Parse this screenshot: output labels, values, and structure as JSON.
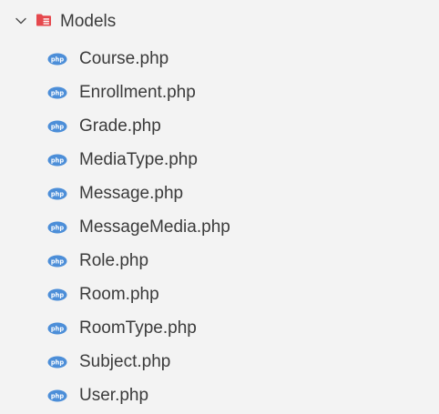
{
  "folder": {
    "name": "Models",
    "expanded": true,
    "icon": "folder-open-icon",
    "chevron_icon": "chevron-down-icon",
    "icon_color": "#e5484d"
  },
  "files": [
    {
      "name": "Course.php",
      "icon": "php-icon"
    },
    {
      "name": "Enrollment.php",
      "icon": "php-icon"
    },
    {
      "name": "Grade.php",
      "icon": "php-icon"
    },
    {
      "name": "MediaType.php",
      "icon": "php-icon"
    },
    {
      "name": "Message.php",
      "icon": "php-icon"
    },
    {
      "name": "MessageMedia.php",
      "icon": "php-icon"
    },
    {
      "name": "Role.php",
      "icon": "php-icon"
    },
    {
      "name": "Room.php",
      "icon": "php-icon"
    },
    {
      "name": "RoomType.php",
      "icon": "php-icon"
    },
    {
      "name": "Subject.php",
      "icon": "php-icon"
    },
    {
      "name": "User.php",
      "icon": "php-icon"
    }
  ],
  "colors": {
    "background": "#f3f3f3",
    "text": "#3b3b3b",
    "php_icon": "#4c8ed8"
  }
}
